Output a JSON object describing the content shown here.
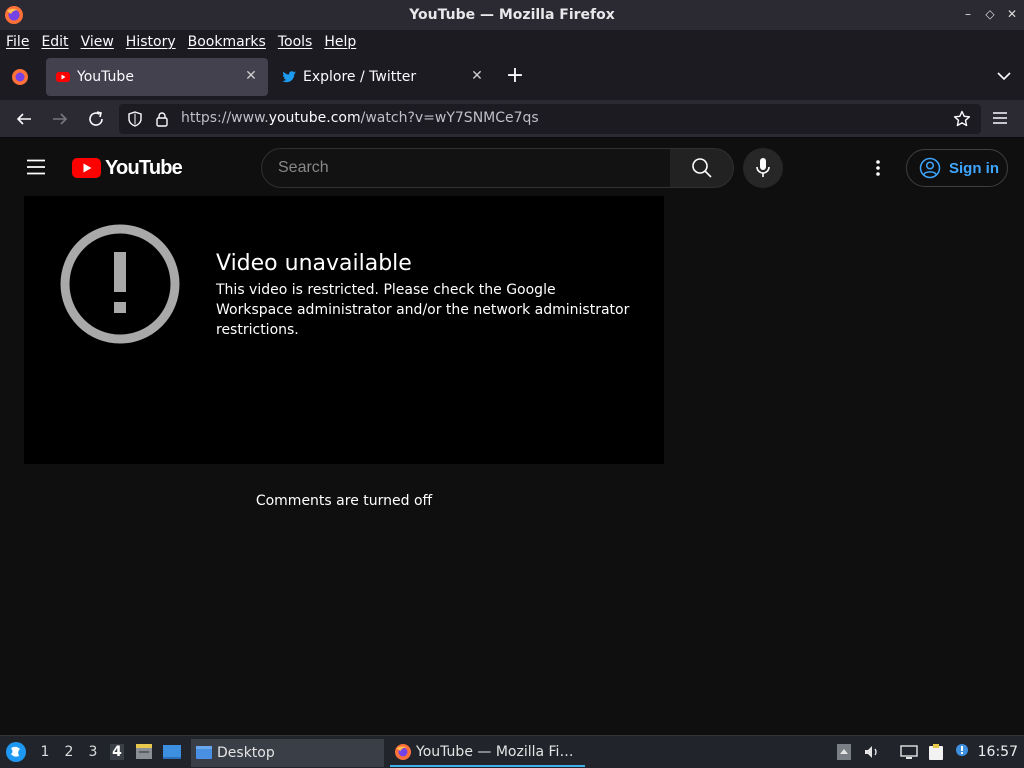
{
  "window": {
    "title": "YouTube — Mozilla Firefox",
    "minimize": "–",
    "maximize": "◇",
    "close": "✕"
  },
  "menu": [
    "File",
    "Edit",
    "View",
    "History",
    "Bookmarks",
    "Tools",
    "Help"
  ],
  "tabs": [
    {
      "label": "YouTube",
      "active": true,
      "favicon": "youtube-favicon"
    },
    {
      "label": "Explore / Twitter",
      "active": false,
      "favicon": "twitter-favicon"
    }
  ],
  "tab_close": "✕",
  "new_tab": "+",
  "urlbar": {
    "scheme": "https://www.",
    "host": "youtube.com",
    "path": "/watch?v=wY7SNMCe7qs"
  },
  "youtube": {
    "logo_text": "YouTube",
    "search_placeholder": "Search",
    "signin_label": "Sign in",
    "error_title": "Video unavailable",
    "error_message": "This video is restricted. Please check the Google Workspace administrator and/or the network administrator restrictions.",
    "comments_status": "Comments are turned off",
    "brand_red": "#ff0000",
    "link_blue": "#3ea6ff"
  },
  "taskbar": {
    "workspaces": [
      "1",
      "2",
      "3",
      "4"
    ],
    "active_workspace": "4",
    "tasks": [
      {
        "label": "Desktop",
        "icon": "desktop-icon"
      },
      {
        "label": "YouTube — Mozilla Fi…",
        "icon": "firefox-icon"
      }
    ],
    "clock": "16:57"
  }
}
